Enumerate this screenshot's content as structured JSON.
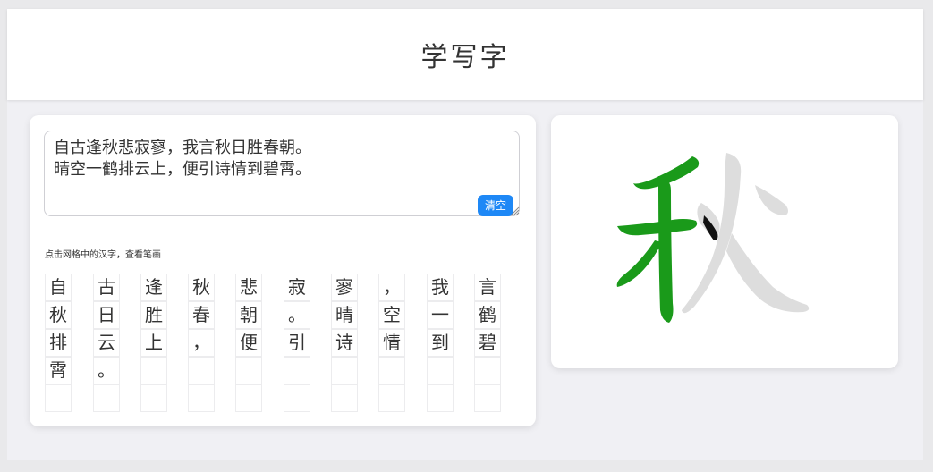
{
  "header": {
    "title": "学写字"
  },
  "input": {
    "lines": [
      "自古逢秋悲寂寥，我言秋日胜春朝。",
      "晴空一鹤排云上，便引诗情到碧霄。"
    ]
  },
  "clear_button": {
    "label": "清空"
  },
  "hint": "点击网格中的汉字，查看笔画",
  "grid": {
    "columns": [
      [
        "自",
        "秋",
        "排",
        "霄",
        ""
      ],
      [
        "古",
        "日",
        "云",
        "。",
        ""
      ],
      [
        "逢",
        "胜",
        "上",
        "",
        ""
      ],
      [
        "秋",
        "春",
        "，",
        "",
        ""
      ],
      [
        "悲",
        "朝",
        "便",
        "",
        ""
      ],
      [
        "寂",
        "。",
        "引",
        "",
        ""
      ],
      [
        "寥",
        "晴",
        "诗",
        "",
        ""
      ],
      [
        "，",
        "空",
        "情",
        "",
        ""
      ],
      [
        "我",
        "一",
        "到",
        "",
        ""
      ],
      [
        "言",
        "鹤",
        "碧",
        "",
        ""
      ]
    ]
  },
  "stroke_view": {
    "character": "秋",
    "colors": {
      "done": "#1a9a1a",
      "current": "#111111",
      "pending": "#dddddd"
    }
  }
}
